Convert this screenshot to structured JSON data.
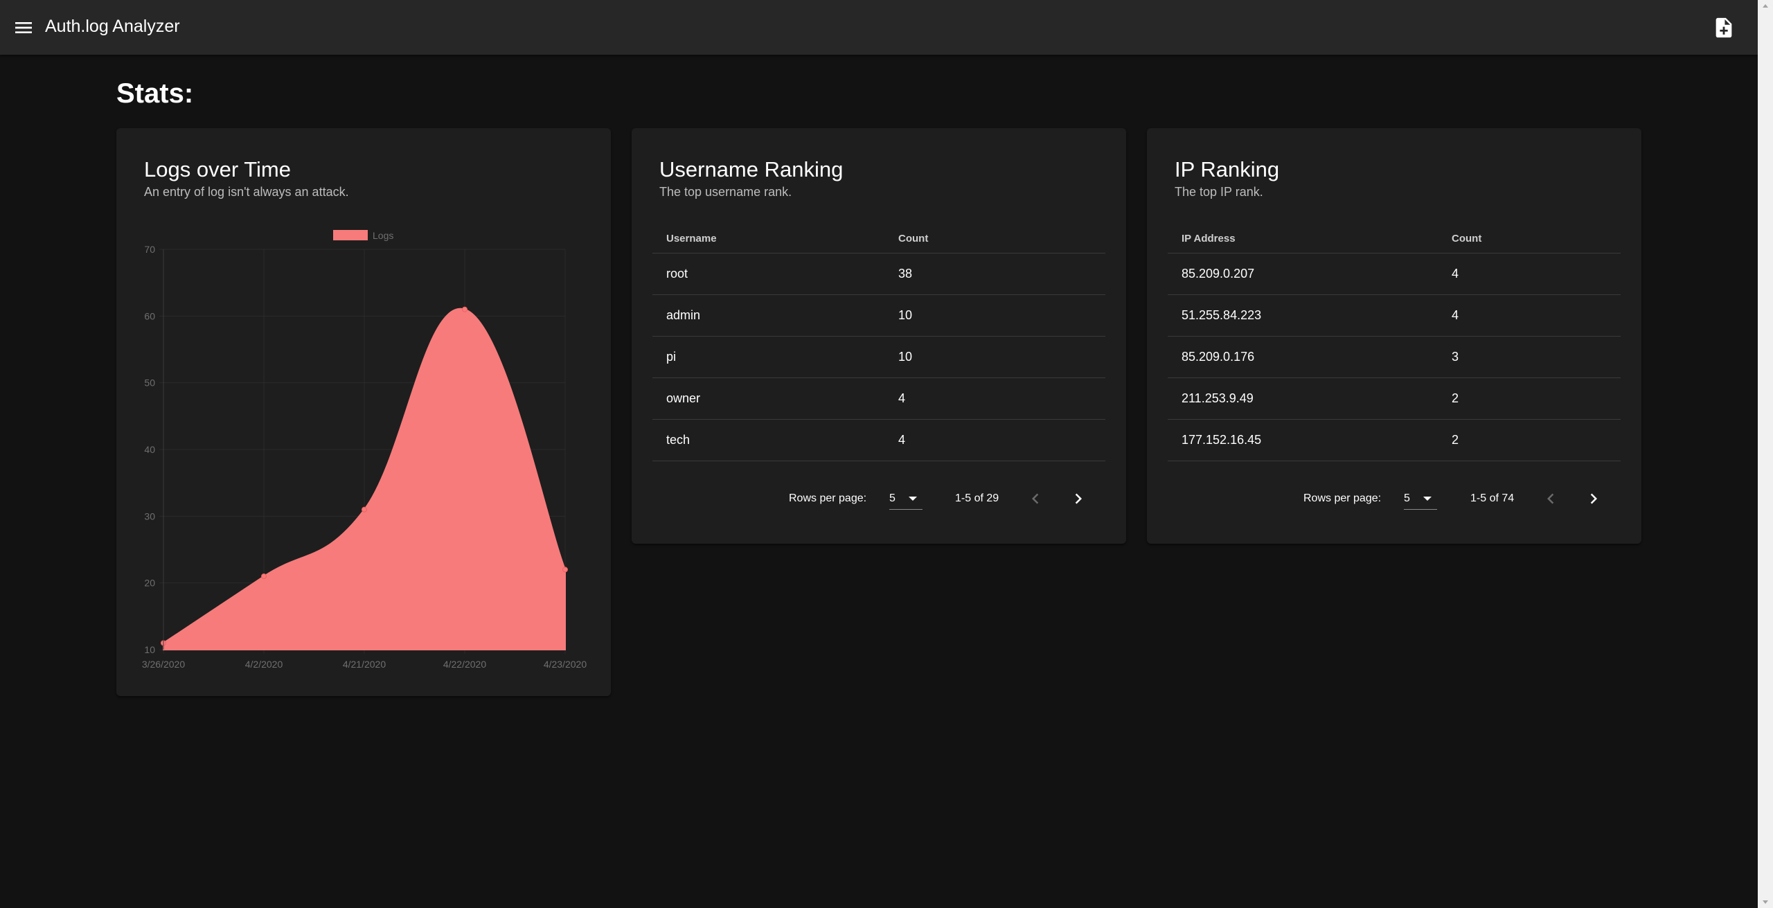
{
  "app": {
    "title": "Auth.log Analyzer",
    "menu_icon": "menu-icon",
    "action_icon": "note-add-icon"
  },
  "page": {
    "title": "Stats:"
  },
  "logs_card": {
    "title": "Logs over Time",
    "subtitle": "An entry of log isn't always an attack."
  },
  "username_card": {
    "title": "Username Ranking",
    "subtitle": "The top username rank.",
    "columns": [
      "Username",
      "Count"
    ],
    "rows": [
      [
        "root",
        "38"
      ],
      [
        "admin",
        "10"
      ],
      [
        "pi",
        "10"
      ],
      [
        "owner",
        "4"
      ],
      [
        "tech",
        "4"
      ]
    ],
    "pagination": {
      "rows_label": "Rows per page:",
      "rows_value": "5",
      "range": "1-5 of 29"
    }
  },
  "ip_card": {
    "title": "IP Ranking",
    "subtitle": "The top IP rank.",
    "columns": [
      "IP Address",
      "Count"
    ],
    "rows": [
      [
        "85.209.0.207",
        "4"
      ],
      [
        "51.255.84.223",
        "4"
      ],
      [
        "85.209.0.176",
        "3"
      ],
      [
        "211.253.9.49",
        "2"
      ],
      [
        "177.152.16.45",
        "2"
      ]
    ],
    "pagination": {
      "rows_label": "Rows per page:",
      "rows_value": "5",
      "range": "1-5 of 74"
    }
  },
  "chart_data": {
    "type": "area",
    "x": [
      "3/26/2020",
      "4/2/2020",
      "4/21/2020",
      "4/22/2020",
      "4/23/2020"
    ],
    "series": [
      {
        "name": "Logs",
        "values": [
          11,
          21,
          31,
          61,
          22
        ],
        "color": "#f77b7b"
      }
    ],
    "ylim": [
      10,
      70
    ],
    "yticks": [
      10,
      20,
      30,
      40,
      50,
      60,
      70
    ],
    "legend": "top",
    "grid": true
  },
  "colors": {
    "background": "#121212",
    "appbar": "#272727",
    "card": "#1e1e1e",
    "accent": "#f77b7b"
  }
}
